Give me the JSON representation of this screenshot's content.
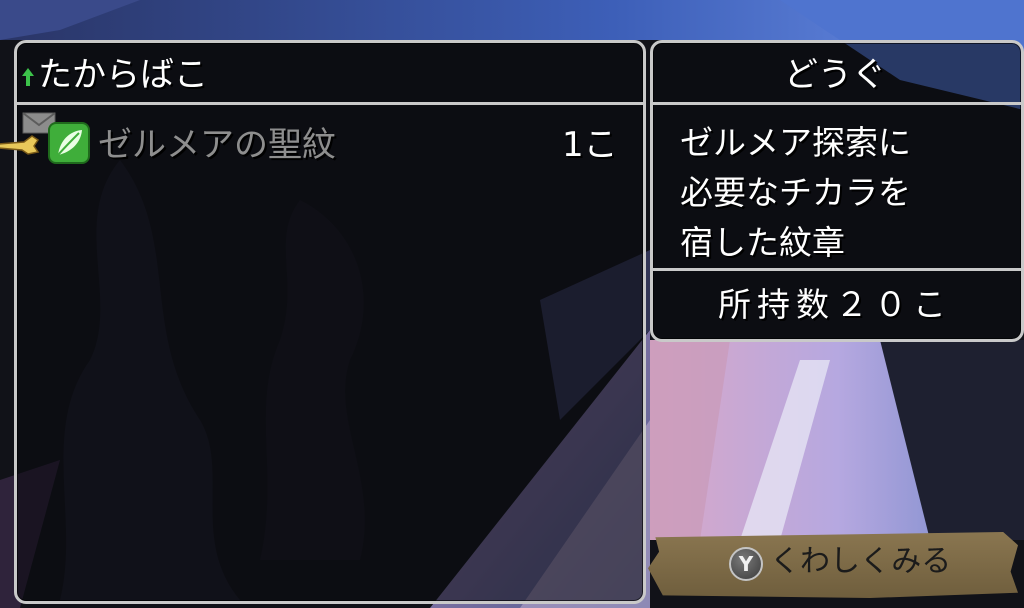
{
  "chest_panel": {
    "title": "たからばこ",
    "items": [
      {
        "name": "ゼルメアの聖紋",
        "count": "1こ"
      }
    ]
  },
  "item_panel": {
    "title": "どうぐ",
    "description": [
      "ゼルメア探索に",
      "必要なチカラを",
      "宿した紋章"
    ],
    "owned": "所持数２０こ"
  },
  "action_button": {
    "glyph": "Y",
    "label": "くわしくみる"
  },
  "colors": {
    "frame": "#c9c9c9",
    "text": "#ffffff",
    "disabled_text": "#8e8e8e",
    "leaf_icon_green": "#3fae3a",
    "button_plate": "#7b6948"
  },
  "icons": [
    "green-arrow-icon",
    "mail-icon",
    "hand-cursor-icon",
    "leaf-item-icon"
  ]
}
